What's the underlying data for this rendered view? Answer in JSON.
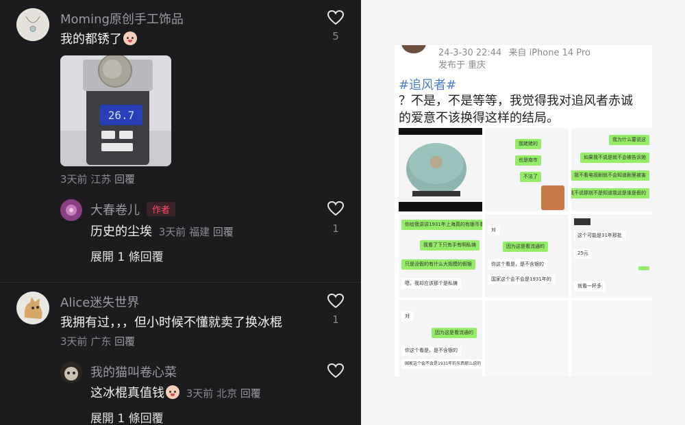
{
  "comments": [
    {
      "username": "Moming原创手工饰品",
      "text": "我的都锈了",
      "meta_time": "3天前",
      "meta_loc": "江苏",
      "reply_label": "回覆",
      "likes": "5",
      "scale_display": "26.7",
      "replies": [
        {
          "username": "大春卷儿",
          "badge": "作者",
          "text": "历史的尘埃",
          "meta_time": "3天前",
          "meta_loc": "福建",
          "reply_label": "回覆",
          "likes": "1"
        }
      ],
      "expand_label": "展開 1 條回覆"
    },
    {
      "username": "Alice迷失世界",
      "text": "我拥有过，，，但小时候不懂就卖了换冰棍",
      "meta_time": "3天前",
      "meta_loc": "广东",
      "reply_label": "回覆",
      "likes": "1",
      "replies": [
        {
          "username": "我的猫叫卷心菜",
          "text": "这冰棍真值钱",
          "meta_time": "3天前",
          "meta_loc": "北京",
          "reply_label": "回覆"
        }
      ],
      "expand_label": "展開 1 條回覆"
    }
  ],
  "weibo": {
    "datetime": "24-3-30 22:44",
    "source": "来自 iPhone 14 Pro",
    "published": "发布于 重庆",
    "hashtag": "#追风者#",
    "text_line1": "？不是，不是等等，我觉得我对追风者赤诚",
    "text_line2": "的爱意不该换得这样的结局。",
    "chat2": [
      "我姥姥的",
      "也是南市",
      "不法了"
    ],
    "chat3": [
      "我为什么要说这",
      "如果我不说是就不会被告诉她",
      "我不看电视剧就不会知道剧里被害",
      "如果我不说那就不是知道我这是谁是假的"
    ],
    "chat4": [
      "你给我讲讲1931年上海真的有银币事吗",
      "我看了下只有手有明私铸",
      "只是没假的有什么大规模的假银",
      "嗯，我却应该那个是私铸"
    ],
    "chat5": [
      "对",
      "因为这是看流通的",
      "你这个看是，是不含银的",
      "国家这个会不会是1931年的"
    ],
    "chat6": [
      "这个可能是31年那批",
      "25元",
      "就看一杯多"
    ],
    "chat7": [
      "对",
      "因为这是看流通的",
      "你这个看是，是不含银的",
      "国家这个会不会是1931年的东西那么说的"
    ]
  }
}
